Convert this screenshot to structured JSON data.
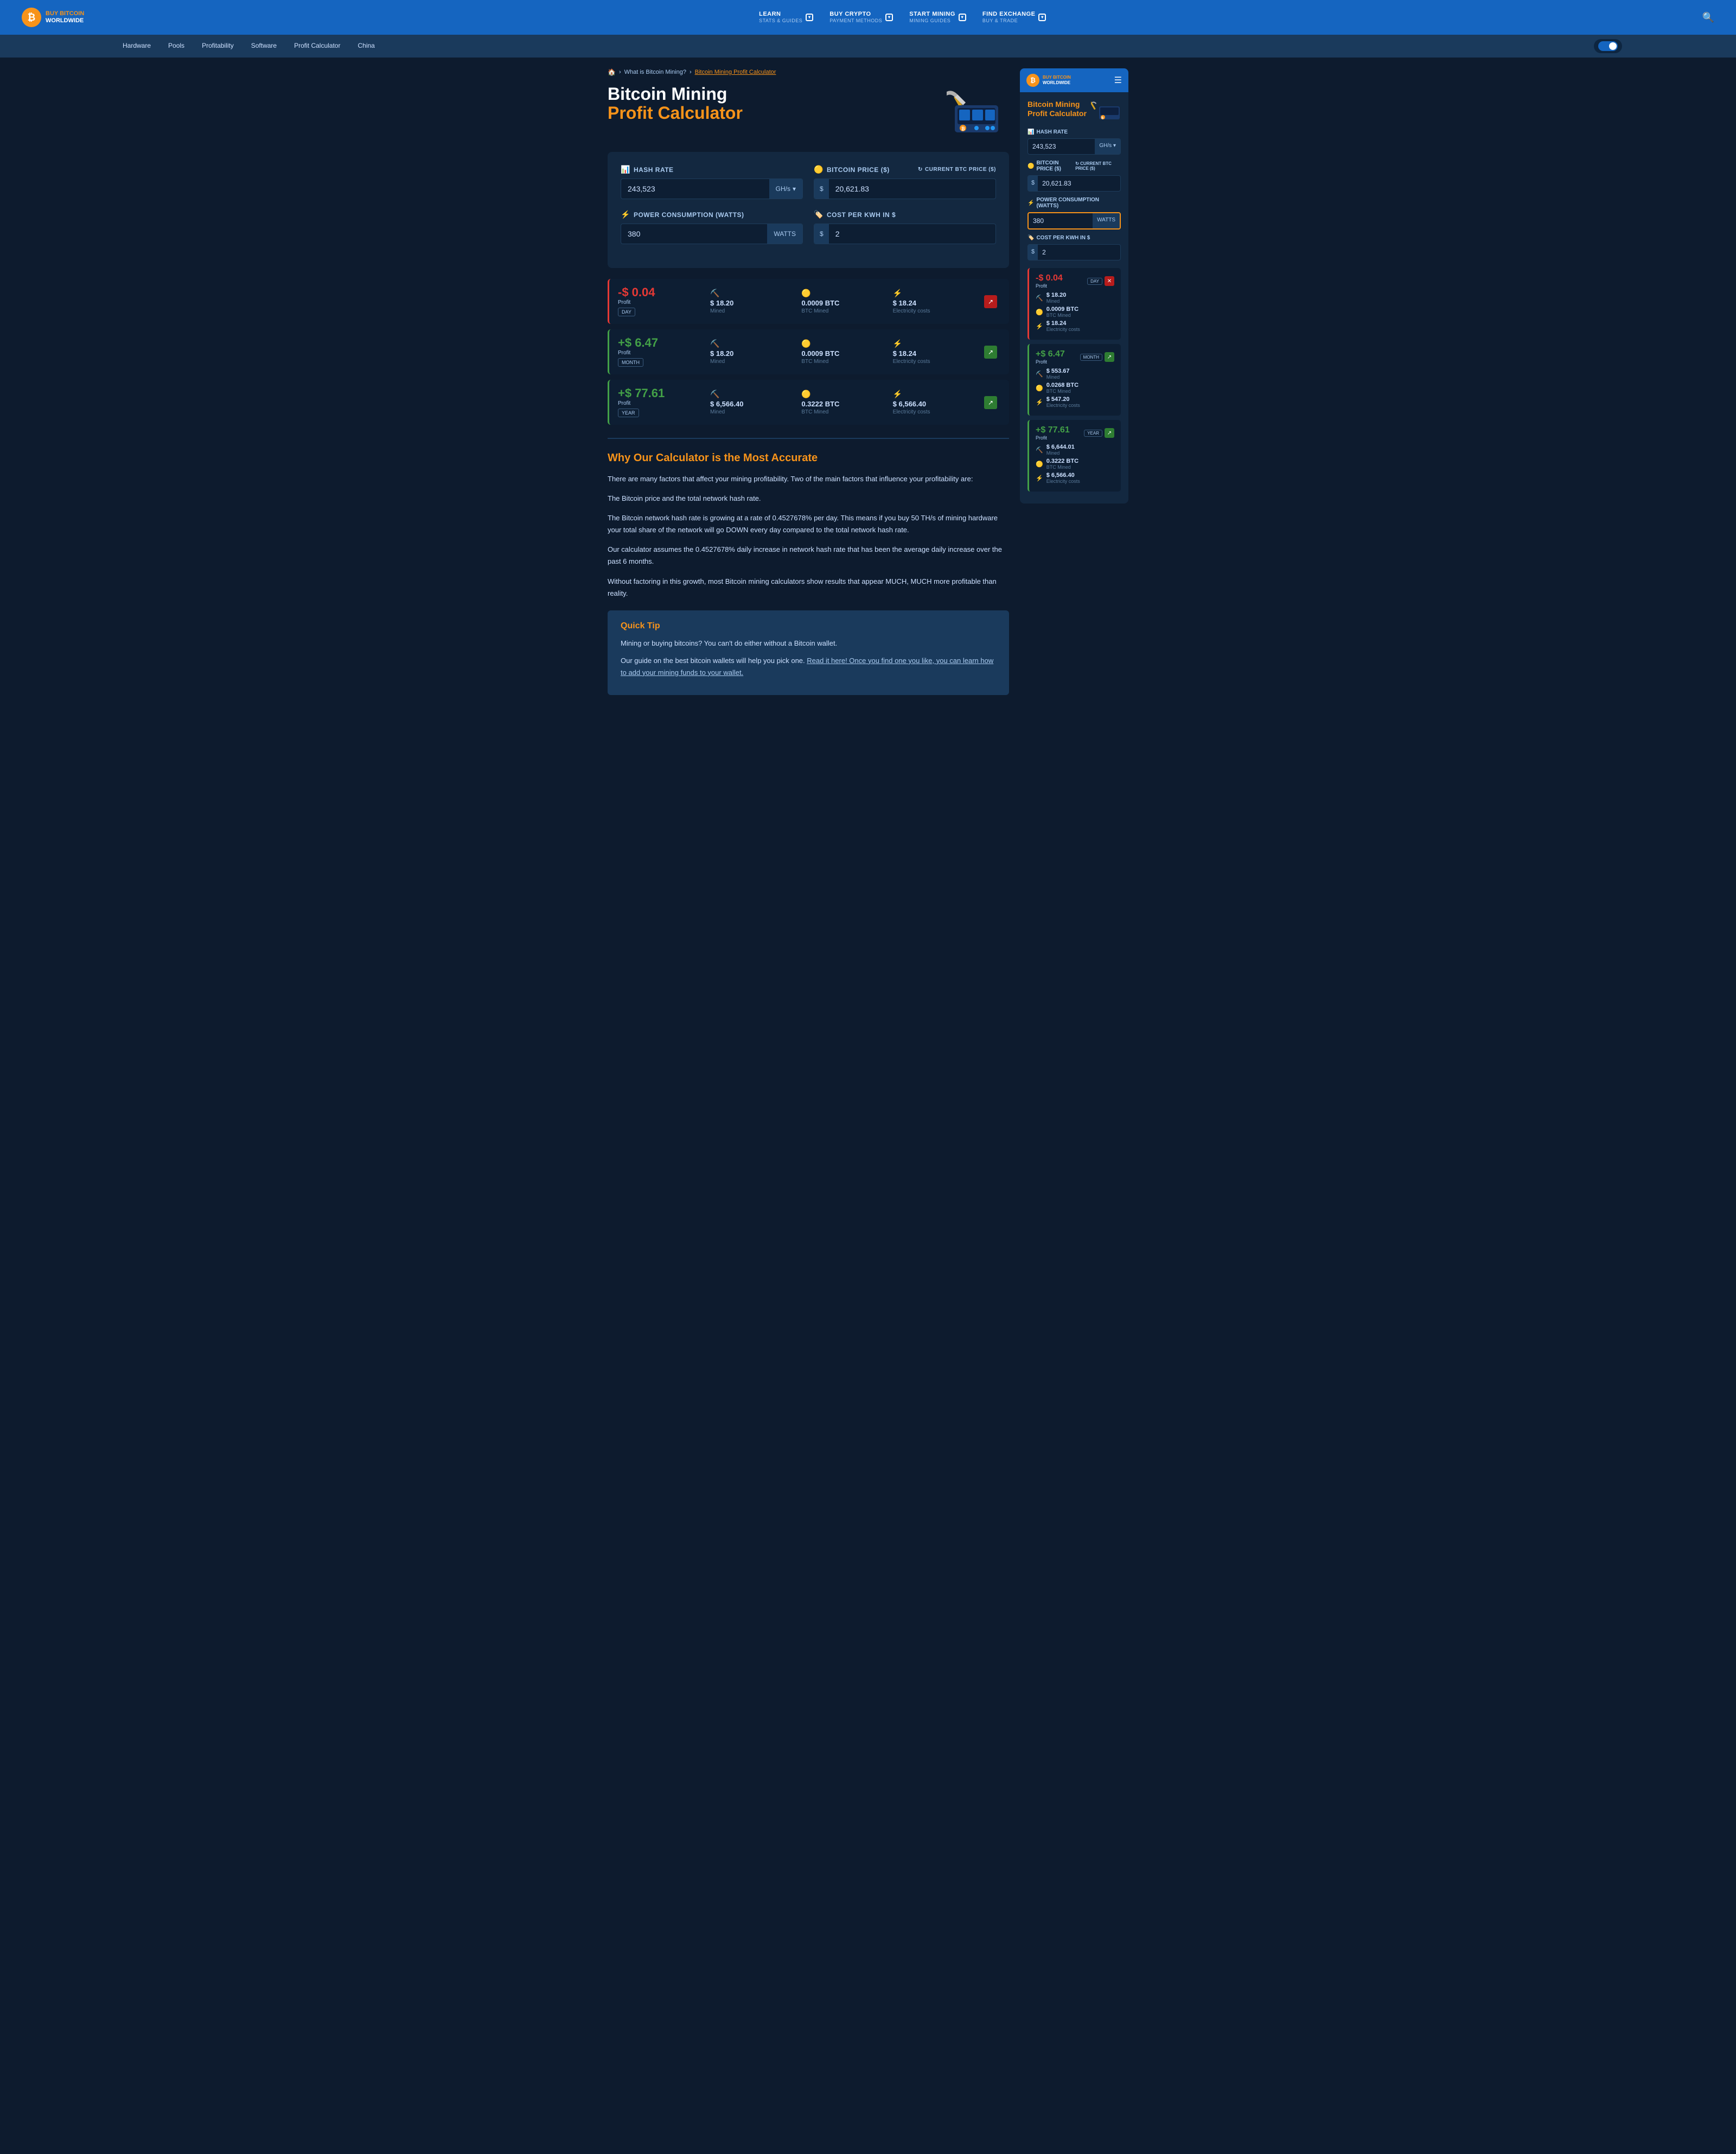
{
  "site": {
    "logo_letter": "₿",
    "logo_name": "BUY BITCOIN",
    "logo_sub": "WORLDWIDE"
  },
  "top_nav": {
    "items": [
      {
        "id": "learn",
        "label": "LEARN",
        "sub": "Stats & guides"
      },
      {
        "id": "buy-crypto",
        "label": "BUY CRYPTO",
        "sub": "Payment methods"
      },
      {
        "id": "start-mining",
        "label": "START MINING",
        "sub": "Mining guides"
      },
      {
        "id": "find-exchange",
        "label": "FIND EXCHANGE",
        "sub": "Buy & trade"
      }
    ],
    "search_placeholder": "Search"
  },
  "sub_nav": {
    "items": [
      {
        "id": "hardware",
        "label": "Hardware"
      },
      {
        "id": "pools",
        "label": "Pools"
      },
      {
        "id": "profitability",
        "label": "Profitability"
      },
      {
        "id": "software",
        "label": "Software"
      },
      {
        "id": "profit-calculator",
        "label": "Profit Calculator"
      },
      {
        "id": "china",
        "label": "China"
      }
    ]
  },
  "breadcrumb": {
    "home": "🏠",
    "items": [
      {
        "label": "What is Bitcoin Mining?",
        "active": false
      },
      {
        "label": "Bitcoin Mining Profit Calculator",
        "active": true
      }
    ]
  },
  "page_header": {
    "title_line1": "Bitcoin Mining",
    "title_line2": "Profit Calculator"
  },
  "calculator": {
    "hash_rate_label": "Hash Rate",
    "hash_rate_value": "243,523",
    "hash_rate_unit": "GH/s",
    "bitcoin_price_label": "Bitcoin Price ($)",
    "bitcoin_price_current": "Current BTC price ($)",
    "bitcoin_price_value": "20,621.83",
    "bitcoin_price_prefix": "$",
    "power_label": "Power consumption (watts)",
    "power_value": "380",
    "power_unit": "WATTS",
    "cost_label": "Cost per KWh in $",
    "cost_prefix": "$",
    "cost_value": "2"
  },
  "results": [
    {
      "period": "DAY",
      "profit": "-$ 0.04",
      "profit_type": "negative",
      "profit_label": "Profit",
      "mined_value": "$ 18.20",
      "mined_label": "Mined",
      "btc_mined": "0.0009 BTC",
      "btc_mined_label": "BTC Mined",
      "electricity": "$ 18.24",
      "electricity_label": "Electricity costs",
      "arrow_type": "neg"
    },
    {
      "period": "MONTH",
      "profit": "+$ 6.47",
      "profit_type": "positive",
      "profit_label": "Profit",
      "mined_value": "$ 18.20",
      "mined_label": "Mined",
      "btc_mined": "0.0009 BTC",
      "btc_mined_label": "BTC Mined",
      "electricity": "$ 18.24",
      "electricity_label": "Electricity costs",
      "arrow_type": "pos"
    },
    {
      "period": "YEAR",
      "profit": "+$ 77.61",
      "profit_type": "positive",
      "profit_label": "Profit",
      "mined_value": "$ 6,566.40",
      "mined_label": "Mined",
      "btc_mined": "0.3222 BTC",
      "btc_mined_label": "BTC Mined",
      "electricity": "$ 6,566.40",
      "electricity_label": "Electricity costs",
      "arrow_type": "pos"
    }
  ],
  "content": {
    "section_title": "Why Our Calculator is the Most Accurate",
    "paragraphs": [
      "There are many factors that affect your mining profitability. Two of the main factors that influence your profitability are:",
      "The Bitcoin price and the total network hash rate.",
      "The Bitcoin network hash rate is growing at a rate of 0.4527678% per day. This means if you buy 50 TH/s of mining hardware your total share of the network will go DOWN every day compared to the total network hash rate.",
      "Our calculator assumes the 0.4527678% daily increase in network hash rate that has been the average daily increase over the past 6 months.",
      "Without factoring in this growth, most Bitcoin mining calculators show results that appear MUCH, MUCH more profitable than reality."
    ]
  },
  "quick_tip": {
    "title": "Quick Tip",
    "paragraph1": "Mining or buying bitcoins? You can't do either without a Bitcoin wallet.",
    "paragraph2_before": "Our guide on the best bitcoin wallets will help you pick one. ",
    "paragraph2_link": "Read it here! Once you find one you like, you can learn how to add your mining funds to your wallet.",
    "paragraph2_link_href": "#"
  },
  "sidebar": {
    "title_line1": "Bitcoin Mining",
    "title_line2": "Profit Calculator",
    "hash_rate_label": "Hash Rate",
    "hash_rate_value": "243,523",
    "hash_rate_unit": "GH/s",
    "bitcoin_price_label": "Bitcoin Price ($)",
    "bitcoin_price_current": "Current BTC price ($)",
    "bitcoin_price_value": "20,621.83",
    "bitcoin_price_prefix": "$",
    "power_label": "Power consumption (watts)",
    "power_value": "380",
    "power_unit": "WATTS",
    "cost_label": "Cost per KWh in $",
    "cost_prefix": "$",
    "cost_value": "2",
    "results": [
      {
        "period": "DAY",
        "profit": "-$ 0.04",
        "profit_type": "negative",
        "profit_label": "Profit",
        "mined_value": "$ 18.20",
        "mined_label": "Mined",
        "btc_mined": "0.0009 BTC",
        "btc_mined_label": "BTC Mined",
        "electricity": "$ 18.24",
        "electricity_label": "Electricity costs",
        "arrow_type": "neg"
      },
      {
        "period": "MONTH",
        "profit": "+$ 6.47",
        "profit_type": "positive",
        "profit_label": "Profit",
        "mined_value": "$ 553.67",
        "mined_label": "Mined",
        "btc_mined": "0.0268 BTC",
        "btc_mined_label": "BTC Mined",
        "electricity": "$ 547.20",
        "electricity_label": "Electricity costs",
        "arrow_type": "pos"
      },
      {
        "period": "YEAR",
        "profit": "+$ 77.61",
        "profit_type": "positive",
        "profit_label": "Profit",
        "mined_value": "$ 6,644.01",
        "mined_label": "Mined",
        "btc_mined": "0.3222 BTC",
        "btc_mined_label": "BTC Mined",
        "electricity": "$ 6,566.40",
        "electricity_label": "Electricity costs",
        "arrow_type": "pos"
      }
    ]
  }
}
